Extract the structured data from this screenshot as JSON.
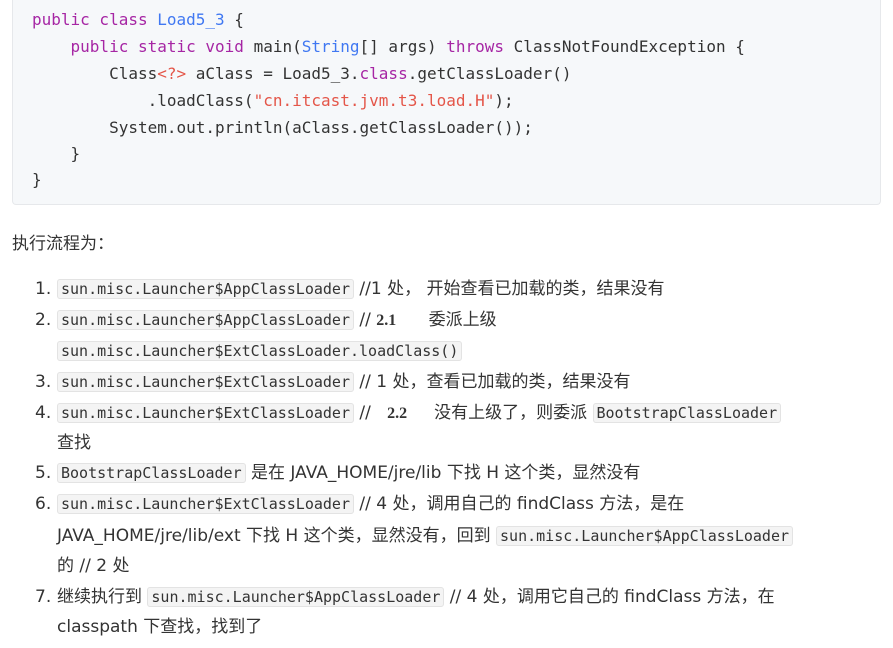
{
  "code": {
    "lines": [
      [
        {
          "t": "public class ",
          "c": "kw"
        },
        {
          "t": "Load5_3",
          "c": "ty"
        },
        {
          "t": " {",
          "c": ""
        }
      ],
      [
        {
          "t": "    ",
          "c": ""
        },
        {
          "t": "public static void ",
          "c": "kw"
        },
        {
          "t": "main(",
          "c": ""
        },
        {
          "t": "String",
          "c": "ty"
        },
        {
          "t": "[] args) ",
          "c": ""
        },
        {
          "t": "throws ",
          "c": "kw"
        },
        {
          "t": "ClassNotFoundException {",
          "c": ""
        }
      ],
      [
        {
          "t": "        Class",
          "c": ""
        },
        {
          "t": "<?>",
          "c": "str"
        },
        {
          "t": " aClass = Load5_3.",
          "c": ""
        },
        {
          "t": "class",
          "c": "kw"
        },
        {
          "t": ".getClassLoader()",
          "c": ""
        }
      ],
      [
        {
          "t": "            .loadClass(",
          "c": ""
        },
        {
          "t": "\"cn.itcast.jvm.t3.load.H\"",
          "c": "str"
        },
        {
          "t": ");",
          "c": ""
        }
      ],
      [
        {
          "t": "        System.out.println(aClass.getClassLoader());",
          "c": ""
        }
      ],
      [
        {
          "t": "    }",
          "c": ""
        }
      ],
      [
        {
          "t": "}",
          "c": ""
        }
      ]
    ]
  },
  "heading": "执行流程为：",
  "steps": [
    {
      "num": "1.",
      "line1": [
        {
          "code": "sun.misc.Launcher$AppClassLoader"
        },
        {
          "text": " //1 处， 开始查看已加载的类，结果没有"
        }
      ]
    },
    {
      "num": "2.",
      "line1": [
        {
          "code": "sun.misc.Launcher$AppClassLoader"
        },
        {
          "text": " // "
        },
        {
          "math": "2.1"
        },
        {
          "text": "      委派上级"
        }
      ],
      "line2": [
        {
          "code": "sun.misc.Launcher$ExtClassLoader.loadClass()"
        }
      ]
    },
    {
      "num": "3.",
      "line1": [
        {
          "code": "sun.misc.Launcher$ExtClassLoader"
        },
        {
          "text": " // 1 处，查看已加载的类，结果没有"
        }
      ]
    },
    {
      "num": "4.",
      "line1": [
        {
          "code": "sun.misc.Launcher$ExtClassLoader"
        },
        {
          "text": " //   "
        },
        {
          "math": "2.2"
        },
        {
          "text": "     没有上级了，则委派 "
        },
        {
          "code": "BootstrapClassLoader"
        }
      ],
      "line2": [
        {
          "text": "查找"
        }
      ]
    },
    {
      "num": "5.",
      "line1": [
        {
          "code": "BootstrapClassLoader"
        },
        {
          "text": " 是在 JAVA_HOME/jre/lib 下找 H 这个类，显然没有"
        }
      ]
    },
    {
      "num": "6.",
      "line1": [
        {
          "code": "sun.misc.Launcher$ExtClassLoader"
        },
        {
          "text": " // 4 处，调用自己的 findClass 方法，是在"
        }
      ],
      "line2": [
        {
          "text": "JAVA_HOME/jre/lib/ext 下找 H 这个类，显然没有，回到 "
        },
        {
          "code": "sun.misc.Launcher$AppClassLoader"
        }
      ],
      "line3": [
        {
          "text": "的 // 2 处"
        }
      ]
    },
    {
      "num": "7.",
      "line1": [
        {
          "text": "继续执行到 "
        },
        {
          "code": "sun.misc.Launcher$AppClassLoader"
        },
        {
          "text": " // 4 处，调用它自己的 findClass 方法，在"
        }
      ],
      "line2": [
        {
          "text": "classpath 下查找，找到了"
        }
      ]
    }
  ]
}
